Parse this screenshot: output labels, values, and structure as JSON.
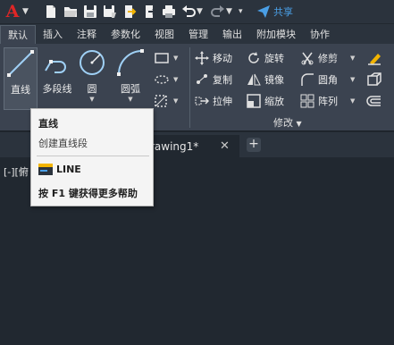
{
  "window": {
    "share_label": "共享"
  },
  "quick_access": [
    "new-file-icon",
    "open-folder-icon",
    "save-icon",
    "save-as-icon",
    "open-from-web-icon",
    "share-drawing-icon",
    "print-icon",
    "undo-icon",
    "redo-icon",
    "customize-toolbar-icon"
  ],
  "ribbon_tabs": [
    {
      "label": "默认",
      "active": true
    },
    {
      "label": "插入"
    },
    {
      "label": "注释"
    },
    {
      "label": "参数化"
    },
    {
      "label": "视图"
    },
    {
      "label": "管理"
    },
    {
      "label": "输出"
    },
    {
      "label": "附加模块"
    },
    {
      "label": "协作"
    }
  ],
  "draw_panel": {
    "line": "直线",
    "polyline": "多段线",
    "circle": "圆",
    "arc": "圆弧"
  },
  "modify_panel": {
    "title": "修改",
    "move": "移动",
    "rotate": "旋转",
    "trim": "修剪",
    "copy": "复制",
    "mirror": "镜像",
    "fillet": "圆角",
    "stretch": "拉伸",
    "scale": "缩放",
    "array": "阵列"
  },
  "file_tabs": [
    {
      "label": "Drawing1*",
      "visible_label": "rawing1*"
    }
  ],
  "viewport_control": "[-][俯",
  "tooltip": {
    "title": "直线",
    "description": "创建直线段",
    "command": "LINE",
    "help": "按 F1 键获得更多帮助"
  },
  "colors": {
    "accent": "#4a9fe6",
    "logo": "#e02626",
    "background": "#212830",
    "ribbon": "#3b4350"
  }
}
